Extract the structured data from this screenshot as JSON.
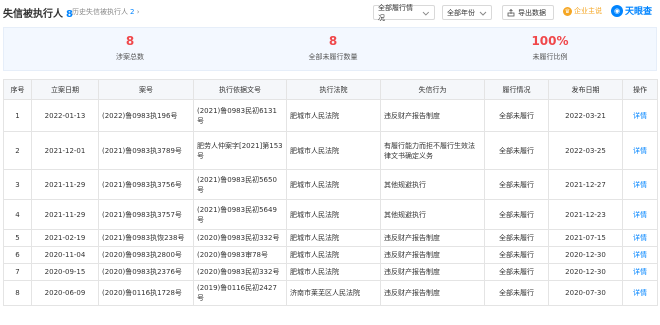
{
  "header": {
    "title": "失信被执行人",
    "title_count": "8",
    "history_label": "历史失信被执行人",
    "history_count": "2",
    "history_arrow": "›",
    "filter_status": "全部履行情况",
    "filter_year": "全部年份",
    "export_label": "导出数据",
    "vip_label": "企业主说",
    "brand_name": "天眼查"
  },
  "stats": [
    {
      "value": "8",
      "label": "涉案总数"
    },
    {
      "value": "8",
      "label": "全部未履行数量"
    },
    {
      "value": "100%",
      "label": "未履行比例"
    }
  ],
  "table": {
    "columns": [
      "序号",
      "立案日期",
      "案号",
      "执行依据文号",
      "执行法院",
      "失信行为",
      "履行情况",
      "发布日期",
      "操作"
    ],
    "rows": [
      {
        "idx": "1",
        "filing_date": "2022-01-13",
        "case_no": "(2022)鲁0983执196号",
        "basis_no": "(2021)鲁0983民初6131号",
        "court": "肥城市人民法院",
        "behavior": "违反财产报告制度",
        "status": "全部未履行",
        "publish_date": "2022-03-21",
        "action": "详情"
      },
      {
        "idx": "2",
        "filing_date": "2021-12-01",
        "case_no": "(2021)鲁0983执3789号",
        "basis_no": "肥劳人仲案字[2021]第153号",
        "court": "肥城市人民法院",
        "behavior": "有履行能力而拒不履行生效法律文书确定义务",
        "status": "全部未履行",
        "publish_date": "2022-03-25",
        "action": "详情"
      },
      {
        "idx": "3",
        "filing_date": "2021-11-29",
        "case_no": "(2021)鲁0983执3756号",
        "basis_no": "(2021)鲁0983民初5650号",
        "court": "肥城市人民法院",
        "behavior": "其他规避执行",
        "status": "全部未履行",
        "publish_date": "2021-12-27",
        "action": "详情"
      },
      {
        "idx": "4",
        "filing_date": "2021-11-29",
        "case_no": "(2021)鲁0983执3757号",
        "basis_no": "(2021)鲁0983民初5649号",
        "court": "肥城市人民法院",
        "behavior": "其他规避执行",
        "status": "全部未履行",
        "publish_date": "2021-12-23",
        "action": "详情"
      },
      {
        "idx": "5",
        "filing_date": "2021-02-19",
        "case_no": "(2021)鲁0983执恢238号",
        "basis_no": "(2020)鲁0983民初332号",
        "court": "肥城市人民法院",
        "behavior": "违反财产报告制度",
        "status": "全部未履行",
        "publish_date": "2021-07-15",
        "action": "详情"
      },
      {
        "idx": "6",
        "filing_date": "2020-11-04",
        "case_no": "(2020)鲁0983执2800号",
        "basis_no": "(2020)鲁0983审78号",
        "court": "肥城市人民法院",
        "behavior": "违反财产报告制度",
        "status": "全部未履行",
        "publish_date": "2020-12-30",
        "action": "详情"
      },
      {
        "idx": "7",
        "filing_date": "2020-09-15",
        "case_no": "(2020)鲁0983执2376号",
        "basis_no": "(2020)鲁0983民初332号",
        "court": "肥城市人民法院",
        "behavior": "违反财产报告制度",
        "status": "全部未履行",
        "publish_date": "2020-12-30",
        "action": "详情"
      },
      {
        "idx": "8",
        "filing_date": "2020-06-09",
        "case_no": "(2020)鲁0116执1728号",
        "basis_no": "(2019)鲁0116民初2427号",
        "court": "济南市莱芜区人民法院",
        "behavior": "违反财产报告制度",
        "status": "全部未履行",
        "publish_date": "2020-07-30",
        "action": "详情"
      }
    ]
  },
  "colors": {
    "accent": "#0084ff",
    "stat_red": "#f0484b",
    "stats_bg": "#f3f8ff",
    "vip": "#f5a623"
  },
  "icons": {
    "export": "export-icon",
    "vip": "crown-icon",
    "brand": "eye-icon",
    "chevron": "chevron-down-icon"
  }
}
